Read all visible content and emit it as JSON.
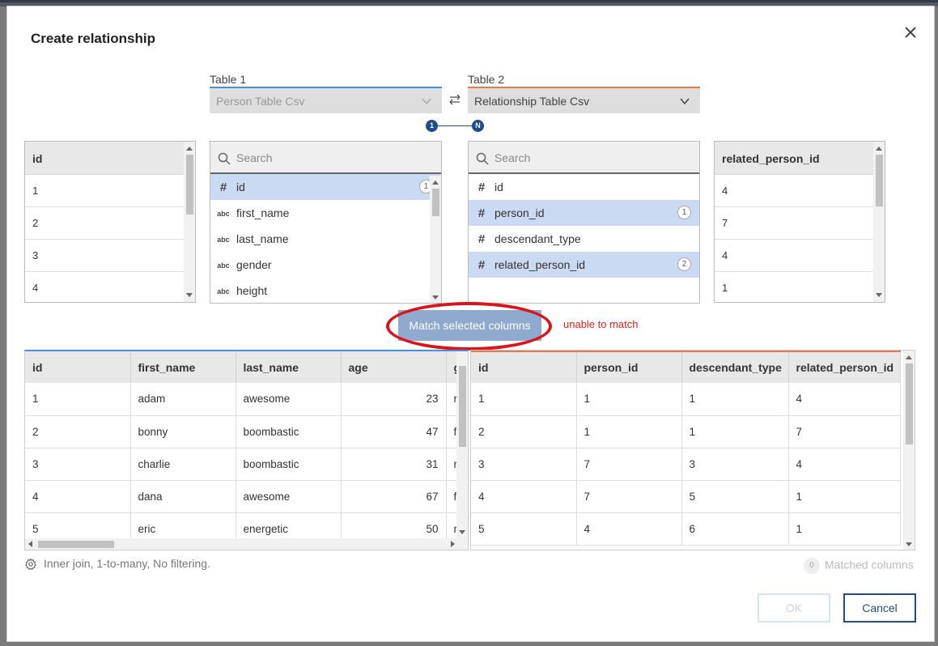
{
  "dialog": {
    "title": "Create relationship"
  },
  "table1": {
    "label": "Table 1",
    "value": "Person Table Csv"
  },
  "table2": {
    "label": "Table 2",
    "value": "Relationship Table Csv"
  },
  "cardinality": {
    "left": "1",
    "right": "N"
  },
  "left_preview": {
    "header": "id",
    "rows": [
      "1",
      "2",
      "3",
      "4"
    ]
  },
  "right_preview": {
    "header": "related_person_id",
    "rows": [
      "4",
      "7",
      "4",
      "1"
    ]
  },
  "left_columns": {
    "search_placeholder": "Search",
    "items": [
      {
        "name": "id",
        "type": "number",
        "icon": "#",
        "selected": true,
        "badge": "1"
      },
      {
        "name": "first_name",
        "type": "string",
        "icon": "abc",
        "selected": false,
        "badge": ""
      },
      {
        "name": "last_name",
        "type": "string",
        "icon": "abc",
        "selected": false,
        "badge": ""
      },
      {
        "name": "gender",
        "type": "string",
        "icon": "abc",
        "selected": false,
        "badge": ""
      },
      {
        "name": "height",
        "type": "string",
        "icon": "abc",
        "selected": false,
        "badge": ""
      }
    ]
  },
  "right_columns": {
    "search_placeholder": "Search",
    "items": [
      {
        "name": "id",
        "type": "number",
        "icon": "#",
        "selected": false,
        "badge": ""
      },
      {
        "name": "person_id",
        "type": "number",
        "icon": "#",
        "selected": true,
        "badge": "1"
      },
      {
        "name": "descendant_type",
        "type": "number",
        "icon": "#",
        "selected": false,
        "badge": ""
      },
      {
        "name": "related_person_id",
        "type": "number",
        "icon": "#",
        "selected": true,
        "badge": "2"
      }
    ]
  },
  "match_button": {
    "label": "Match selected columns"
  },
  "annotation": {
    "text": "unable to match",
    "color": "#e0201c"
  },
  "grid1": {
    "headers": [
      "id",
      "first_name",
      "last_name",
      "age",
      "g"
    ],
    "rows": [
      [
        "1",
        "adam",
        "awesome",
        "23",
        "r"
      ],
      [
        "2",
        "bonny",
        "boombastic",
        "47",
        "f"
      ],
      [
        "3",
        "charlie",
        "boombastic",
        "31",
        "r"
      ],
      [
        "4",
        "dana",
        "awesome",
        "67",
        "f"
      ],
      [
        "5",
        "eric",
        "energetic",
        "50",
        "r"
      ]
    ]
  },
  "grid2": {
    "headers": [
      "id",
      "person_id",
      "descendant_type",
      "related_person_id"
    ],
    "rows": [
      [
        "1",
        "1",
        "1",
        "4"
      ],
      [
        "2",
        "1",
        "1",
        "7"
      ],
      [
        "3",
        "7",
        "3",
        "4"
      ],
      [
        "4",
        "7",
        "5",
        "1"
      ],
      [
        "5",
        "4",
        "6",
        "1"
      ]
    ]
  },
  "footer": {
    "join_summary": "Inner join, 1-to-many, No filtering.",
    "matched_count": "0",
    "matched_label": "Matched columns",
    "ok_label": "OK",
    "cancel_label": "Cancel"
  },
  "colors": {
    "accent": "#1e4d8c",
    "table1_accent": "#4a90d9",
    "table2_accent": "#e8784d",
    "selected_row": "#c9daf2"
  }
}
